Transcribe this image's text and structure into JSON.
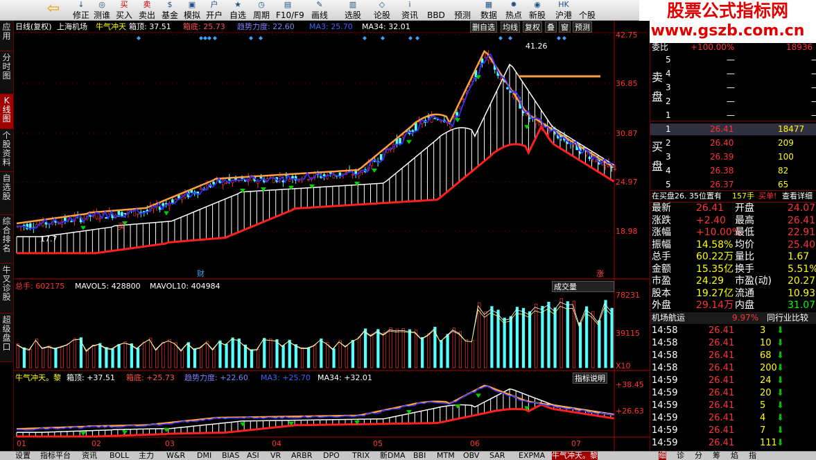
{
  "toolbar": {
    "items": [
      {
        "label": "修正",
        "icon": "↓"
      },
      {
        "label": "测谁",
        "icon": "◎"
      },
      {
        "label": "买入",
        "icon": "买"
      },
      {
        "label": "卖出",
        "icon": "卖"
      },
      {
        "label": "基金",
        "icon": "$"
      },
      {
        "label": "模拟",
        "icon": "▣"
      },
      {
        "label": "开户",
        "icon": "户"
      },
      {
        "label": "自选股",
        "icon": "★"
      },
      {
        "label": "周期",
        "icon": "◷"
      },
      {
        "label": "F10/F9",
        "icon": "▤"
      },
      {
        "label": "画线",
        "icon": "✎"
      },
      {
        "label": "选股",
        "icon": "▥"
      },
      {
        "label": "论股堂",
        "icon": "◇"
      },
      {
        "label": "资讯",
        "icon": "i"
      },
      {
        "label": "BBD",
        "icon": ""
      },
      {
        "label": "预测",
        "icon": ""
      },
      {
        "label": "数据",
        "icon": "▦"
      },
      {
        "label": "热点",
        "icon": "✹"
      },
      {
        "label": "新股",
        "icon": "◉"
      },
      {
        "label": "沪港通",
        "icon": "HK"
      },
      {
        "label": "个股",
        "icon": ""
      }
    ]
  },
  "watermark": {
    "line1": "股票公式指标网",
    "line2": "www.gszb.com.cn"
  },
  "left_tabs": [
    "应用",
    "分时图",
    "K线图",
    "个股资料",
    "自选股",
    "综合排名",
    "牛叉诊股",
    "超级盘口"
  ],
  "chart": {
    "header": {
      "period": "日线(复权)",
      "stock": "上海机场",
      "indicator": "牛气冲天",
      "box_top": "箱顶: 37.51",
      "box_bottom": "箱底: 25.73",
      "trend": "趋势力度: 22.60",
      "ma3": "MA3: 25.70",
      "ma34": "MA34: 32.01"
    },
    "buttons": [
      "删自选",
      "均线",
      "复权",
      "叠",
      "窗",
      "预测"
    ],
    "price_axis": [
      "42.75",
      "36.85",
      "30.87",
      "24.97",
      "18.98"
    ],
    "high_label": "41.26",
    "low_label": "17.7",
    "cai_label": "财",
    "zhang_label": "涨",
    "vol_header": {
      "total": "总手: 602175",
      "mavol5": "MAVOL5: 428800",
      "mavol10": "MAVOL10: 404984"
    },
    "vol_select": "成交量",
    "vol_axis": [
      "78231",
      "39115",
      "X10"
    ],
    "ind_header": {
      "name": "牛气冲天。黎",
      "box_top": "箱顶: +37.51",
      "box_bottom": "箱底: +25.73",
      "trend": "趋势力度: +22.60",
      "ma3": "MA3: +25.70",
      "ma34": "MA34: +32.01"
    },
    "ind_btn": "指标说明",
    "ind_axis": [
      "+38.45",
      "+26.63"
    ],
    "months": [
      "01",
      "02",
      "03",
      "04",
      "05",
      "06",
      "07"
    ],
    "buy_label": "买"
  },
  "panel": {
    "weibi": {
      "label": "委比",
      "value": "+100.00%",
      "diff": "18936"
    },
    "sell_label": "卖盘",
    "buy_label": "买盘",
    "sell": [
      {
        "n": "5",
        "p": "—",
        "v": "—"
      },
      {
        "n": "4",
        "p": "—",
        "v": "—"
      },
      {
        "n": "3",
        "p": "—",
        "v": "—"
      },
      {
        "n": "2",
        "p": "—",
        "v": "—"
      },
      {
        "n": "1",
        "p": "—",
        "v": "—"
      }
    ],
    "buy": [
      {
        "n": "1",
        "p": "26.41",
        "v": "18477"
      },
      {
        "n": "2",
        "p": "26.40",
        "v": "209"
      },
      {
        "n": "3",
        "p": "26.39",
        "v": "100"
      },
      {
        "n": "4",
        "p": "26.38",
        "v": "82"
      },
      {
        "n": "5",
        "p": "26.37",
        "v": "65"
      }
    ],
    "notice": {
      "text": "在买盘26. 35位置有",
      "hands": "157手",
      "buy": "买单!",
      "link": "查看详细"
    },
    "stats": [
      {
        "l1": "最新",
        "v1": "26.41",
        "l2": "开盘",
        "v2": "24.07"
      },
      {
        "l1": "涨跌",
        "v1": "+2.40",
        "l2": "最高",
        "v2": "26.41"
      },
      {
        "l1": "涨幅",
        "v1": "+10.00%",
        "l2": "最低",
        "v2": "22.91"
      },
      {
        "l1": "振幅",
        "v1": "14.58%",
        "l2": "均价",
        "v2": "25.40"
      },
      {
        "l1": "总手",
        "v1": "60.22万",
        "l2": "量比",
        "v2": "1.67"
      },
      {
        "l1": "金额",
        "v1": "15.35亿",
        "l2": "换手",
        "v2": "5.51%"
      },
      {
        "l1": "市盈",
        "v1": "24.29",
        "l2": "市盈(动)",
        "v2": "20.27"
      },
      {
        "l1": "股本",
        "v1": "19.27亿",
        "l2": "流通",
        "v2": "10.93亿"
      },
      {
        "l1": "外盘",
        "v1": "29.14万",
        "l2": "内盘",
        "v2": "31.07万"
      }
    ],
    "sector": {
      "name": "机场航运",
      "pct": "9.97%",
      "btn": "同行业比较"
    },
    "ticks": [
      {
        "t": "14:58",
        "p": "26.41",
        "v": "3"
      },
      {
        "t": "14:58",
        "p": "26.41",
        "v": "10"
      },
      {
        "t": "14:58",
        "p": "26.41",
        "v": "68"
      },
      {
        "t": "14:58",
        "p": "26.41",
        "v": "200"
      },
      {
        "t": "14:59",
        "p": "26.41",
        "v": "24"
      },
      {
        "t": "14:59",
        "p": "26.41",
        "v": "20"
      },
      {
        "t": "14:59",
        "p": "26.41",
        "v": "5"
      },
      {
        "t": "14:59",
        "p": "26.41",
        "v": "4"
      },
      {
        "t": "14:59",
        "p": "26.41",
        "v": "7"
      },
      {
        "t": "14:59",
        "p": "26.41",
        "v": "111"
      }
    ]
  },
  "bottom_tabs": [
    "设置",
    "指标平台",
    "资讯",
    "BOLL",
    "主力",
    "W&R",
    "DMI",
    "BIAS",
    "ASI",
    "VR",
    "ARBR",
    "DPO",
    "TRIX",
    "新DMA",
    "BBI",
    "MTM",
    "OBV",
    "SAR",
    "EXPMA",
    "牛气冲天。黎"
  ],
  "bottom_right_tabs": [
    "细",
    "诊",
    "分",
    "筹",
    "焰",
    "指"
  ],
  "colors": {
    "up": "#ff3333",
    "down": "#54ffff",
    "yellow": "#ffff00",
    "orange": "#ffa040",
    "blue": "#4040ff",
    "bg": "#000000"
  }
}
